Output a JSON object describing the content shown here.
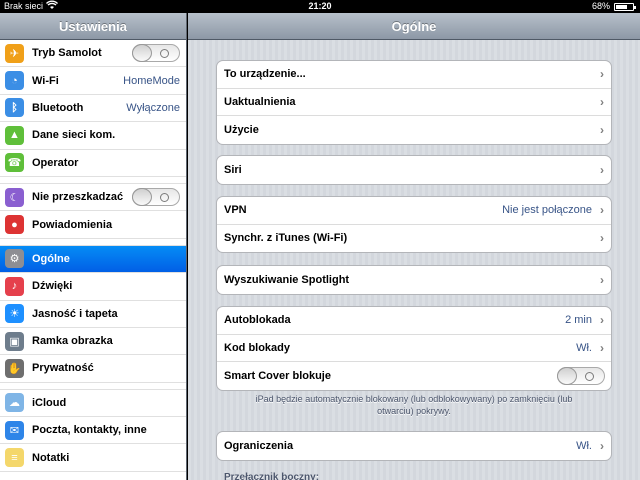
{
  "status": {
    "carrier": "Brak sieci",
    "time": "21:20",
    "battery": "68%",
    "battery_level": 0.68
  },
  "sidebar": {
    "title": "Ustawienia",
    "items": [
      {
        "label": "Tryb Samolot",
        "icon": "airplane-icon",
        "color": "#f0a019",
        "toggle": true
      },
      {
        "label": "Wi-Fi",
        "value": "HomeMode",
        "icon": "wifi-icon",
        "color": "#3b8ee5"
      },
      {
        "label": "Bluetooth",
        "value": "Wyłączone",
        "icon": "bluetooth-icon",
        "color": "#3b8ee5"
      },
      {
        "label": "Dane sieci kom.",
        "icon": "cellular-icon",
        "color": "#5fbf3a"
      },
      {
        "label": "Operator",
        "icon": "phone-icon",
        "color": "#5fbf3a"
      },
      {
        "label": "Nie przeszkadzać",
        "icon": "moon-icon",
        "color": "#8a5fd0",
        "toggle": true
      },
      {
        "label": "Powiadomienia",
        "icon": "notifications-icon",
        "color": "#d33"
      },
      {
        "label": "Ogólne",
        "icon": "gear-icon",
        "color": "#8e8e93"
      },
      {
        "label": "Dźwięki",
        "icon": "sounds-icon",
        "color": "#e5404c"
      },
      {
        "label": "Jasność i tapeta",
        "icon": "brightness-icon",
        "color": "#1e90ff"
      },
      {
        "label": "Ramka obrazka",
        "icon": "picture-frame-icon",
        "color": "#6e7d8c"
      },
      {
        "label": "Prywatność",
        "icon": "hand-icon",
        "color": "#6e6e6e"
      },
      {
        "label": "iCloud",
        "icon": "icloud-icon",
        "color": "#7fb5e6"
      },
      {
        "label": "Poczta, kontakty, inne",
        "icon": "mail-icon",
        "color": "#2e85e8"
      },
      {
        "label": "Notatki",
        "icon": "notes-icon",
        "color": "#f4d76b"
      }
    ]
  },
  "main": {
    "title": "Ogólne",
    "groups": [
      [
        {
          "label": "To urządzenie..."
        },
        {
          "label": "Uaktualnienia"
        },
        {
          "label": "Użycie"
        }
      ],
      [
        {
          "label": "Siri"
        }
      ],
      [
        {
          "label": "VPN",
          "value": "Nie jest połączone"
        },
        {
          "label": "Synchr. z iTunes (Wi-Fi)"
        }
      ],
      [
        {
          "label": "Wyszukiwanie Spotlight"
        }
      ],
      [
        {
          "label": "Autoblokada",
          "value": "2 min"
        },
        {
          "label": "Kod blokady",
          "value": "Wł."
        },
        {
          "label": "Smart Cover blokuje"
        }
      ],
      [
        {
          "label": "Ograniczenia",
          "value": "Wł."
        }
      ]
    ],
    "footnote": "iPad będzie automatycznie blokowany (lub odblokowywany) po zamknięciu (lub otwarciu) pokrywy.",
    "section_partial": "Przełącznik boczny:"
  }
}
